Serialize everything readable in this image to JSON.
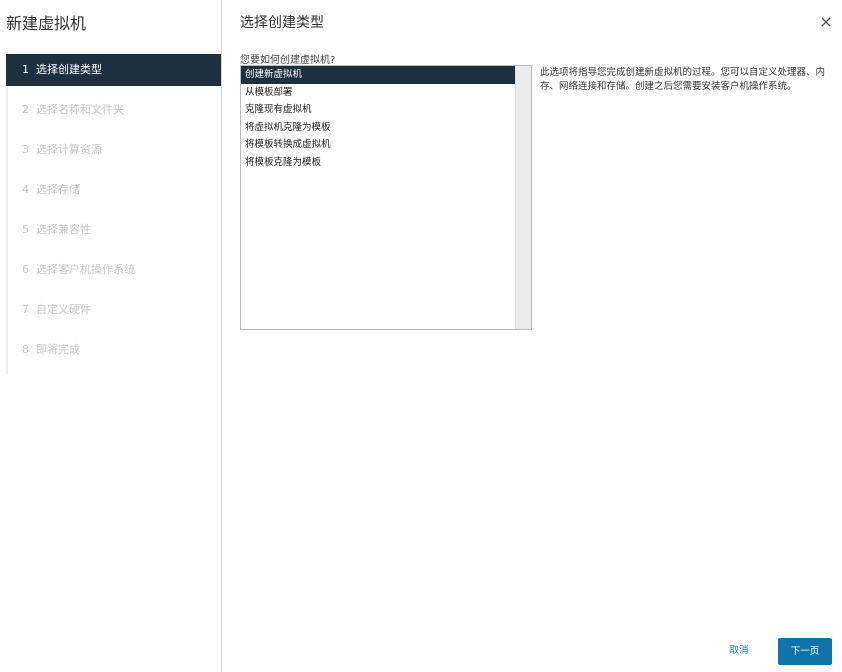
{
  "wizard": {
    "title": "新建虚拟机",
    "steps": [
      {
        "num": "1",
        "label": "选择创建类型"
      },
      {
        "num": "2",
        "label": "选择名称和文件夹"
      },
      {
        "num": "3",
        "label": "选择计算资源"
      },
      {
        "num": "4",
        "label": "选择存储"
      },
      {
        "num": "5",
        "label": "选择兼容性"
      },
      {
        "num": "6",
        "label": "选择客户机操作系统"
      },
      {
        "num": "7",
        "label": "自定义硬件"
      },
      {
        "num": "8",
        "label": "即将完成"
      }
    ],
    "active_step": 1
  },
  "page": {
    "title": "选择创建类型",
    "close_icon": "close-icon",
    "question": "您要如何创建虚拟机?",
    "options": [
      "创建新虚拟机",
      "从模板部署",
      "克隆现有虚拟机",
      "将虚拟机克隆为模板",
      "将模板转换成虚拟机",
      "将模板克隆为模板"
    ],
    "selected_option": 0,
    "description": "此选项将指导您完成创建新虚拟机的过程。您可以自定义处理器、内存、网络连接和存储。创建之后您需要安装客户机操作系统。"
  },
  "footer": {
    "cancel_label": "取消",
    "next_label": "下一页"
  },
  "colors": {
    "active_bg": "#1e3040",
    "primary_button": "#1174a9",
    "link": "#1a73a8",
    "disabled_text": "#c6c6c6"
  }
}
